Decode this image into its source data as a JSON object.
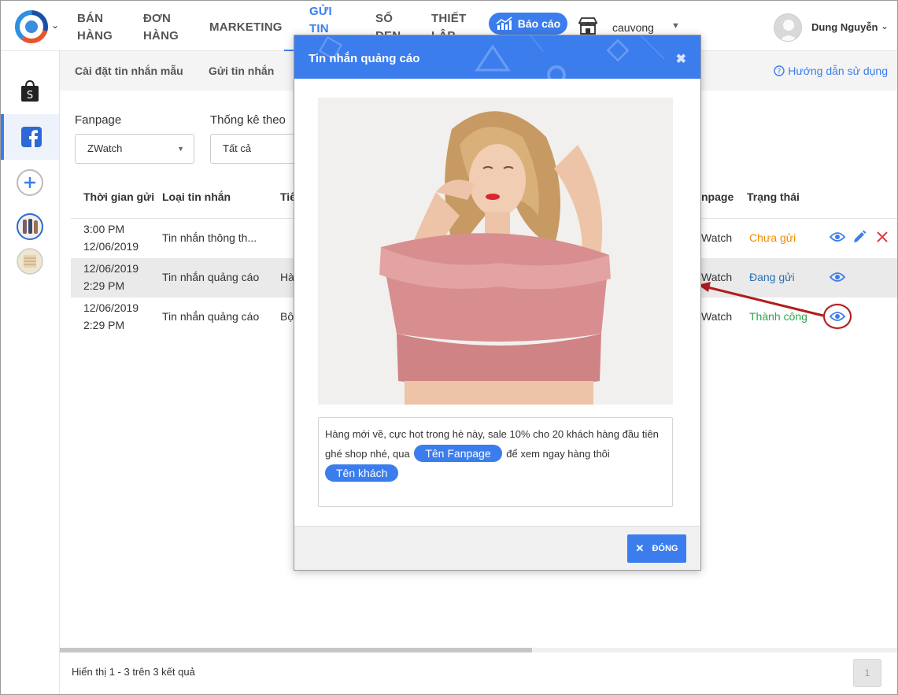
{
  "nav": {
    "items": [
      {
        "line1": "BÁN",
        "line2": "HÀNG"
      },
      {
        "line1": "ĐƠN",
        "line2": "HÀNG"
      },
      {
        "line1": "MARKETING",
        "line2": ""
      },
      {
        "line1": "GỬI",
        "line2": "TIN"
      },
      {
        "line1": "SỔ",
        "line2": "ĐEN"
      },
      {
        "line1": "THIẾT",
        "line2": "LẬP"
      }
    ],
    "report_label": "Báo cáo",
    "store_name": "cauvong",
    "user_name": "Dung Nguyễn",
    "accent_color": "#3b7ded"
  },
  "subnav": {
    "items": [
      "Cài đặt tin nhắn mẫu",
      "Gửi tin nhắn"
    ],
    "help_label": "Hướng dẫn sử dụng"
  },
  "filters": {
    "fanpage_label": "Fanpage",
    "fanpage_value": "ZWatch",
    "stats_label": "Thống kê theo",
    "stats_value": "Tất cả"
  },
  "table": {
    "headers": [
      "Thời gian gửi",
      "Loại tin nhắn",
      "Tiê",
      "npage",
      "Trạng thái"
    ],
    "rows": [
      {
        "date_line1": "3:00 PM",
        "date_line2": "12/06/2019",
        "type": "Tin nhắn thông th...",
        "title": "",
        "fanpage": "Watch",
        "status": "Chưa gửi"
      },
      {
        "date_line1": "12/06/2019",
        "date_line2": "2:29 PM",
        "type": "Tin nhắn quảng cáo",
        "title": "Hà",
        "fanpage": "Watch",
        "status": "Đang gửi"
      },
      {
        "date_line1": "12/06/2019",
        "date_line2": "2:29 PM",
        "type": "Tin nhắn quảng cáo",
        "title": "Bộ",
        "fanpage": "Watch",
        "status": "Thành công"
      }
    ]
  },
  "footer": {
    "summary": "Hiển thị 1 - 3 trên 3 kết quả",
    "page": "1"
  },
  "modal": {
    "title": "Tin nhắn quảng cáo",
    "message_part1": "Hàng mới về, cực hot trong hè này, sale 10% cho 20 khách hàng đầu tiên ghé shop nhé, qua",
    "tag_fanpage": "Tên Fanpage",
    "message_part2": "để xem ngay hàng thôi",
    "tag_customer": "Tên khách",
    "close_label": "ĐÓNG"
  }
}
